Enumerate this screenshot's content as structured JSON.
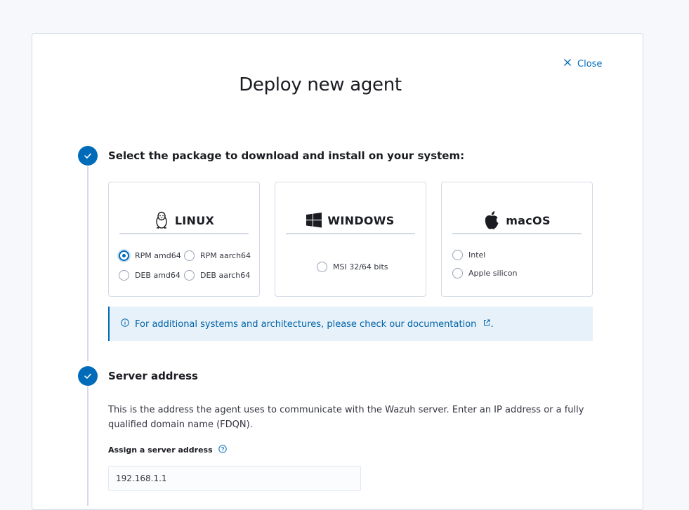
{
  "header": {
    "title": "Deploy new agent",
    "close_label": "Close"
  },
  "step1": {
    "title": "Select the package to download and install on your system:",
    "cards": {
      "linux": {
        "name": "LINUX",
        "options": [
          "RPM amd64",
          "RPM aarch64",
          "DEB amd64",
          "DEB aarch64"
        ],
        "selected": "RPM amd64"
      },
      "windows": {
        "name": "WINDOWS",
        "options": [
          "MSI 32/64 bits"
        ]
      },
      "macos": {
        "name": "macOS",
        "options": [
          "Intel",
          "Apple silicon"
        ]
      }
    },
    "callout": "For additional systems and architectures, please check our documentation",
    "callout_suffix": "."
  },
  "step2": {
    "title": "Server address",
    "description": "This is the address the agent uses to communicate with the Wazuh server. Enter an IP address or a fully qualified domain name (FDQN).",
    "field_label": "Assign a server address",
    "value": "192.168.1.1"
  },
  "colors": {
    "accent": "#006bb8",
    "callout_bg": "#e6f1fa",
    "border": "#d3dae6"
  }
}
